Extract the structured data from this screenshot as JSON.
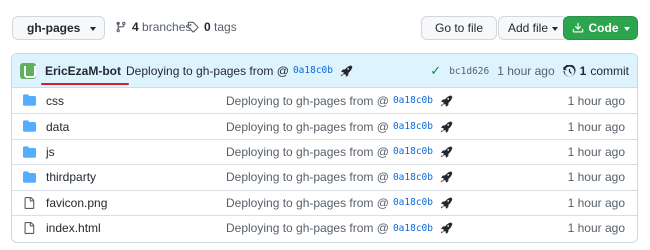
{
  "toolbar": {
    "branch_name": "gh-pages",
    "branches_count": "4",
    "branches_label": "branches",
    "tags_count": "0",
    "tags_label": "tags",
    "go_to_file": "Go to file",
    "add_file": "Add file",
    "code": "Code"
  },
  "commit": {
    "author": "EricEzaM-bot",
    "message": "Deploying to gh-pages from @",
    "sha": "0a18c0b",
    "latest_sha": "bc1d626",
    "time": "1 hour ago",
    "commits_count": "1",
    "commits_label": "commit"
  },
  "files": [
    {
      "name": "css",
      "type": "folder",
      "message": "Deploying to gh-pages from @",
      "sha": "0a18c0b",
      "time": "1 hour ago"
    },
    {
      "name": "data",
      "type": "folder",
      "message": "Deploying to gh-pages from @",
      "sha": "0a18c0b",
      "time": "1 hour ago"
    },
    {
      "name": "js",
      "type": "folder",
      "message": "Deploying to gh-pages from @",
      "sha": "0a18c0b",
      "time": "1 hour ago"
    },
    {
      "name": "thirdparty",
      "type": "folder",
      "message": "Deploying to gh-pages from @",
      "sha": "0a18c0b",
      "time": "1 hour ago"
    },
    {
      "name": "favicon.png",
      "type": "file",
      "message": "Deploying to gh-pages from @",
      "sha": "0a18c0b",
      "time": "1 hour ago"
    },
    {
      "name": "index.html",
      "type": "file",
      "message": "Deploying to gh-pages from @",
      "sha": "0a18c0b",
      "time": "1 hour ago"
    }
  ],
  "colors": {
    "accent_green": "#2da44e",
    "folder_blue": "#54aeff",
    "header_bg": "#ddf4ff",
    "link_blue": "#0969da",
    "annotation_red": "#cf222e"
  }
}
